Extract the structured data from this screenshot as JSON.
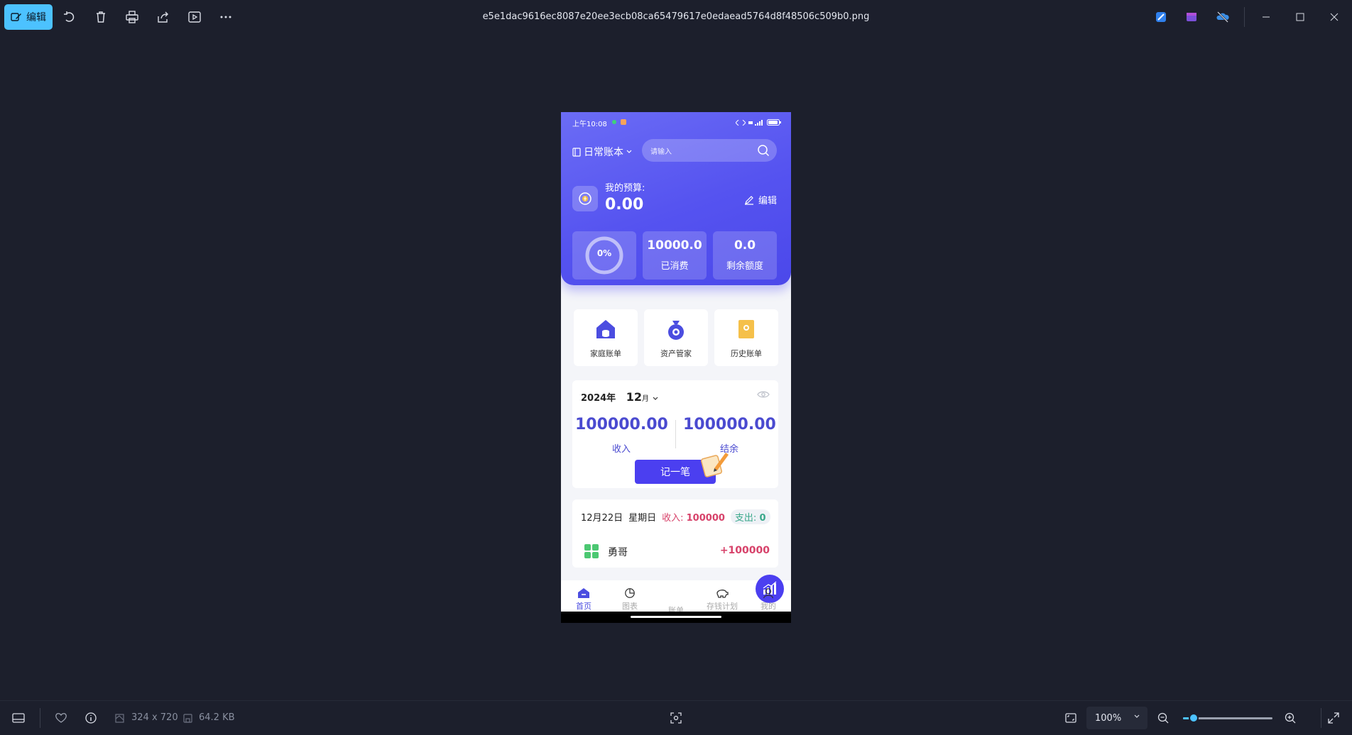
{
  "window": {
    "file_title": "e5e1dac9616ec8087e20ee3ecb08ca65479617e0edaead5764d8f48506c509b0.png",
    "edit_label": "编辑",
    "accent_color": "#4cc2ff"
  },
  "statusbar": {
    "dimensions": "324 x 720",
    "file_size": "64.2 KB",
    "zoom_value": "100%",
    "zoom_fraction": 0.12
  },
  "app": {
    "status_time": "上午10:08",
    "book_name": "日常账本",
    "search_placeholder": "请输入",
    "budget_label": "我的预算:",
    "budget_value": "0.00",
    "edit_label": "编辑",
    "progress_text": "0%",
    "spent_value": "10000.0",
    "spent_label": "已消费",
    "remaining_value": "0.0",
    "remaining_label": "剩余额度",
    "menu": [
      {
        "label": "家庭账单",
        "icon": "house-icon"
      },
      {
        "label": "资产管家",
        "icon": "money-bag-icon"
      },
      {
        "label": "历史账单",
        "icon": "history-icon"
      }
    ],
    "year": "2024年",
    "month": "12",
    "month_suffix": "月",
    "income_value": "100000.00",
    "income_label": "收入",
    "balance_value": "100000.00",
    "balance_label": "结余",
    "record_label": "记一笔",
    "day_date": "12月22日",
    "day_weekday": "星期日",
    "day_income_label": "收入:",
    "day_income_value": "100000",
    "day_expense_label": "支出:",
    "day_expense_value": "0",
    "entry_name": "勇哥",
    "entry_amount": "+100000",
    "tabs": [
      {
        "label": "首页",
        "icon": "home-icon"
      },
      {
        "label": "图表",
        "icon": "pie-chart-icon"
      },
      {
        "label": "账单",
        "icon": "bar-chart-icon"
      },
      {
        "label": "存钱计划",
        "icon": "piggy-bank-icon"
      },
      {
        "label": "我的",
        "icon": "user-icon"
      }
    ],
    "brand_color": "#4b3ff0",
    "income_color": "#d7426a",
    "expense_color": "#3aa88b"
  }
}
